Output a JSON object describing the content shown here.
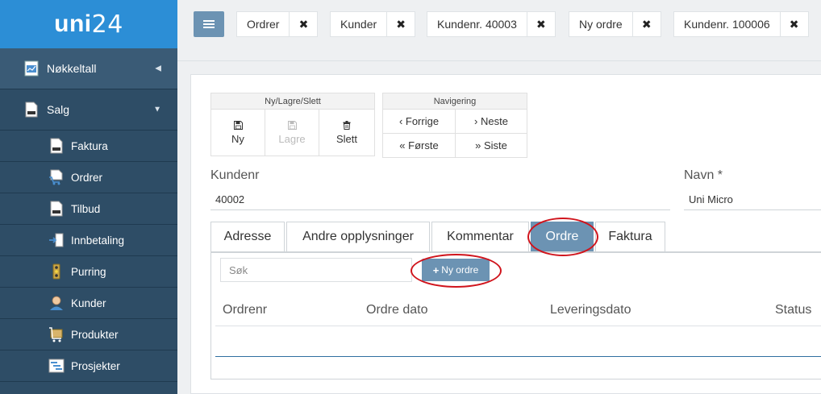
{
  "app": {
    "logo_part1": "uni",
    "logo_part2": "24"
  },
  "sidebar": {
    "sections": [
      {
        "label": "Nøkkeltall",
        "icon": "chart-icon",
        "indicator": "◀"
      },
      {
        "label": "Salg",
        "icon": "invoice-icon",
        "indicator": "▼"
      }
    ],
    "items": [
      {
        "label": "Faktura",
        "icon": "invoice-icon"
      },
      {
        "label": "Ordrer",
        "icon": "cart-icon"
      },
      {
        "label": "Tilbud",
        "icon": "offer-icon"
      },
      {
        "label": "Innbetaling",
        "icon": "payment-icon"
      },
      {
        "label": "Purring",
        "icon": "traffic-light-icon"
      },
      {
        "label": "Kunder",
        "icon": "customer-icon"
      },
      {
        "label": "Produkter",
        "icon": "product-icon"
      },
      {
        "label": "Prosjekter",
        "icon": "project-icon"
      }
    ]
  },
  "topbar": {
    "tabs": [
      {
        "label": "Ordrer"
      },
      {
        "label": "Kunder"
      },
      {
        "label": "Kundenr. 40003"
      },
      {
        "label": "Ny ordre"
      },
      {
        "label": "Kundenr. 100006"
      }
    ],
    "close_glyph": "✖"
  },
  "toolbar": {
    "group1_title": "Ny/Lagre/Slett",
    "new_label": "Ny",
    "save_label": "Lagre",
    "delete_label": "Slett",
    "group2_title": "Navigering",
    "prev_label": "‹ Forrige",
    "next_label": "› Neste",
    "first_label": "« Første",
    "last_label": "» Siste"
  },
  "form": {
    "customer_no_label": "Kundenr",
    "customer_no_value": "40002",
    "name_label": "Navn *",
    "name_value": "Uni Micro"
  },
  "content_tabs": [
    {
      "label": "Adresse"
    },
    {
      "label": "Andre opplysninger"
    },
    {
      "label": "Kommentar"
    },
    {
      "label": "Ordre"
    },
    {
      "label": "Faktura"
    }
  ],
  "order_panel": {
    "search_placeholder": "Søk",
    "new_order_label": "Ny ordre",
    "columns": [
      "Ordrenr",
      "Ordre dato",
      "Leveringsdato",
      "Status"
    ]
  },
  "colors": {
    "accent": "#6c93b3",
    "sidebar": "#2e4d66",
    "logo_bg": "#2c8ed6",
    "highlight_ring": "#d0141c"
  }
}
